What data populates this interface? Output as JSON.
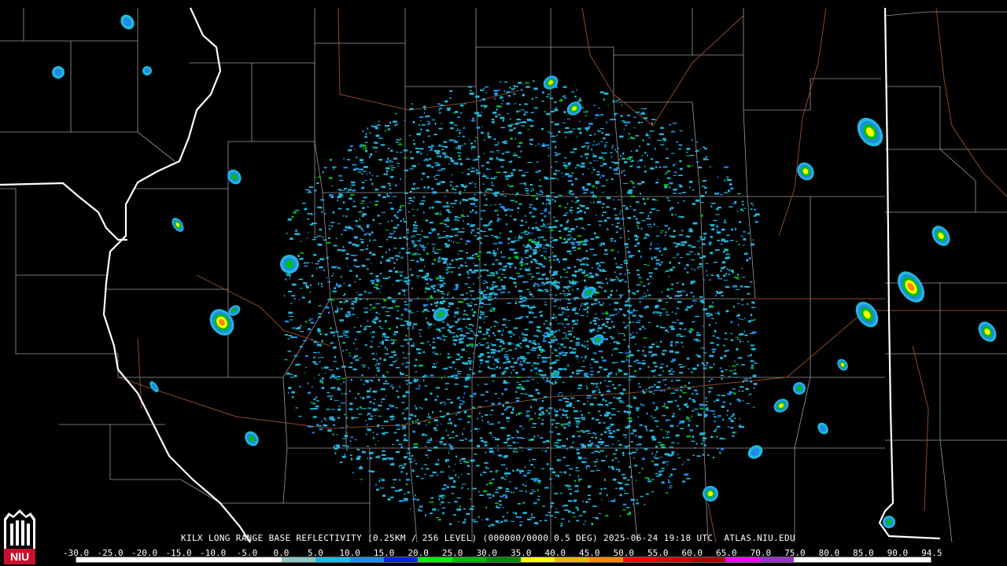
{
  "product": {
    "station": "KILX",
    "description": "LONG RANGE BASE REFLECTIVITY (0.25KM / 256 LEVEL) (000000/0000 0.5 DEG)",
    "timestamp": "2025-06-24 19:18 UTC",
    "source": "ATLAS.NIU.EDU"
  },
  "logo": {
    "text": "NIU",
    "colors": {
      "red": "#c8102e",
      "white": "#ffffff",
      "black": "#000000"
    }
  },
  "colorscale": {
    "labels": [
      "-30.0",
      "-25.0",
      "-20.0",
      "-15.0",
      "-10.0",
      "-5.0",
      "0.0",
      "5.0",
      "10.0",
      "15.0",
      "20.0",
      "25.0",
      "30.0",
      "35.0",
      "40.0",
      "45.0",
      "50.0",
      "55.0",
      "60.0",
      "65.0",
      "70.0",
      "75.0",
      "80.0",
      "85.0",
      "90.0",
      "94.5"
    ],
    "colors": [
      "#ffffff",
      "#ffffff",
      "#ffffff",
      "#ffffff",
      "#ffffff",
      "#ffffff",
      "#8ec6c6",
      "#1fb8e8",
      "#1f8ae8",
      "#0022ee",
      "#00ee00",
      "#00b800",
      "#008800",
      "#ffff00",
      "#e7b800",
      "#ff8800",
      "#ff0000",
      "#d80000",
      "#b00000",
      "#ff00ff",
      "#9933cc",
      "#ffffff",
      "#ffffff",
      "#ffffff",
      "#ffffff"
    ]
  },
  "map": {
    "colors": {
      "background": "#000000",
      "county_lines": "#9a9a9a",
      "state_lines": "#ffffff",
      "roads": "#8a4a2a",
      "echo_low": "#22b8dc",
      "echo_light": "#1f8ae8",
      "echo_mid": "#00c000",
      "echo_high": "#ffff00",
      "echo_heavy": "#ff8800",
      "echo_core": "#ff0000"
    }
  }
}
